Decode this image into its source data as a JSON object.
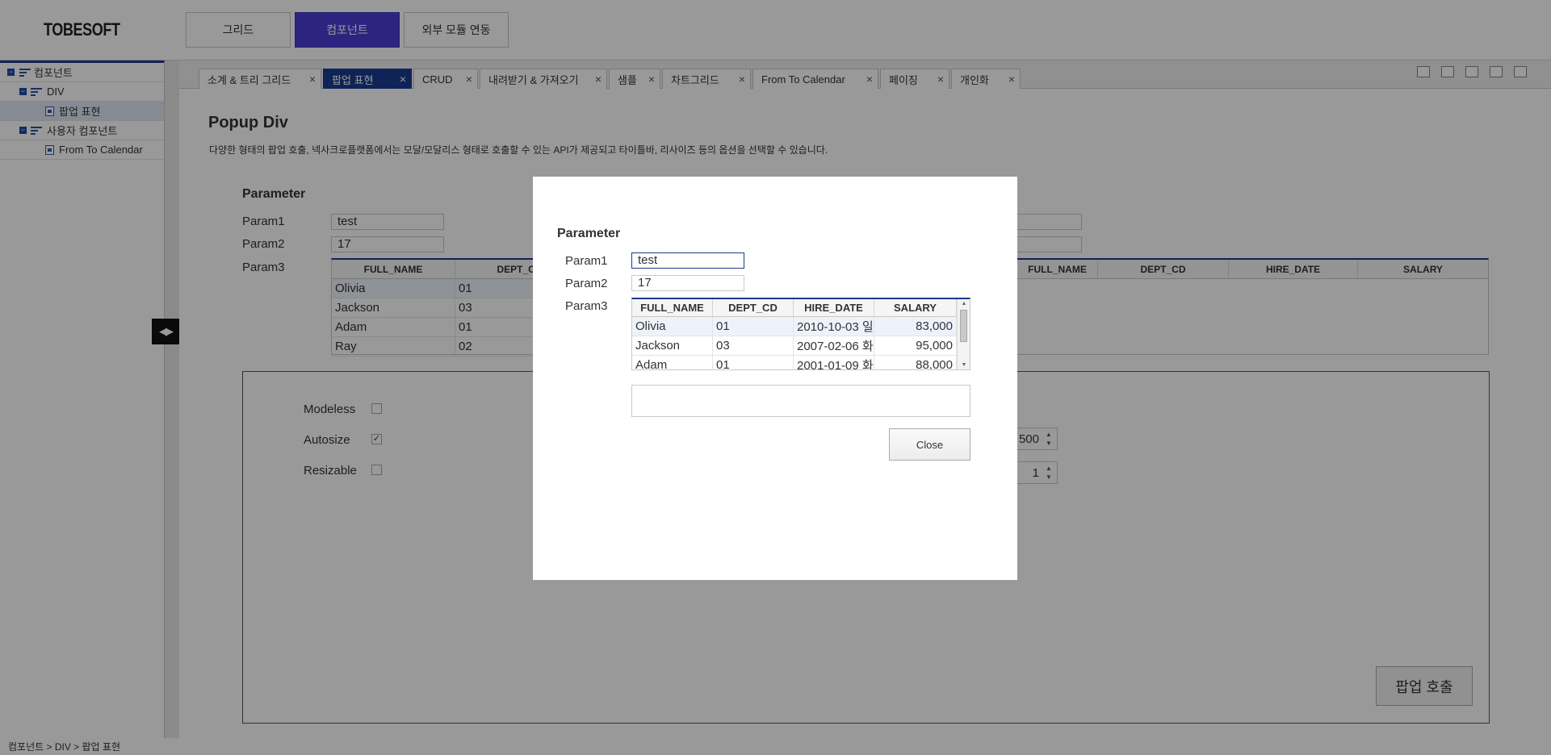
{
  "app": {
    "logo": "TOBESOFT"
  },
  "topmenu": [
    "그리드",
    "컴포넌트",
    "외부 모듈 연동"
  ],
  "tree": {
    "items": [
      {
        "label": "컴포넌트",
        "type": "folder"
      },
      {
        "label": "DIV",
        "type": "folder"
      },
      {
        "label": "팝업 표현",
        "type": "doc"
      },
      {
        "label": "사용자 컴포넌트",
        "type": "folder"
      },
      {
        "label": "From To Calendar",
        "type": "doc"
      }
    ]
  },
  "tabs": [
    {
      "label": "소계 & 트리 그리드"
    },
    {
      "label": "팝업 표현"
    },
    {
      "label": "CRUD"
    },
    {
      "label": "내려받기 & 가져오기"
    },
    {
      "label": "샘플"
    },
    {
      "label": "차트그리드"
    },
    {
      "label": "From To Calendar"
    },
    {
      "label": "페이징"
    },
    {
      "label": "개인화"
    }
  ],
  "tab_close_glyph": "×",
  "page": {
    "title": "Popup Div",
    "description": "다양한 형태의 팝업 호출, 넥사크로플랫폼에서는 모달/모달리스 형태로 호출할 수 있는 API가 제공되고 타이틀바, 리사이즈 등의 옵션을 선택할 수 있습니다.",
    "param_title": "Parameter",
    "param1_label": "Param1",
    "param1_value": "test",
    "param2_label": "Param2",
    "param2_value": "17",
    "param3_label": "Param3",
    "grid_headers": [
      "FULL_NAME",
      "DEPT_CD",
      "FULL_NAME",
      "DEPT_CD",
      "HIRE_DATE",
      "SALARY"
    ],
    "grid_rows": [
      {
        "name": "Olivia",
        "dept": "01"
      },
      {
        "name": "Jackson",
        "dept": "03"
      },
      {
        "name": "Adam",
        "dept": "01"
      },
      {
        "name": "Ray",
        "dept": "02"
      }
    ],
    "options": {
      "modeless_label": "Modeless",
      "autosize_label": "Autosize",
      "resizable_label": "Resizable",
      "modeless_checked": false,
      "autosize_checked": true,
      "resizable_checked": false,
      "spin1_value": "500",
      "spin2_value": "1"
    },
    "popup_button": "팝업 호출"
  },
  "statusbar": {
    "path": "컴포넌트 > DIV > 팝업 표현"
  },
  "modal": {
    "param_title": "Parameter",
    "param1_label": "Param1",
    "param1_value": "test",
    "param2_label": "Param2",
    "param2_value": "17",
    "param3_label": "Param3",
    "grid_headers": [
      "FULL_NAME",
      "DEPT_CD",
      "HIRE_DATE",
      "SALARY"
    ],
    "grid_rows": [
      {
        "name": "Olivia",
        "dept": "01",
        "hire": "2010-10-03 일",
        "salary": "83,000"
      },
      {
        "name": "Jackson",
        "dept": "03",
        "hire": "2007-02-06 화",
        "salary": "95,000"
      },
      {
        "name": "Adam",
        "dept": "01",
        "hire": "2001-01-09 화",
        "salary": "88,000"
      }
    ],
    "close_button": "Close"
  },
  "colors": {
    "accent": "#4a3fd6",
    "tab_active": "#1a3c8f",
    "overlay": "rgba(0,0,0,0.40)"
  }
}
